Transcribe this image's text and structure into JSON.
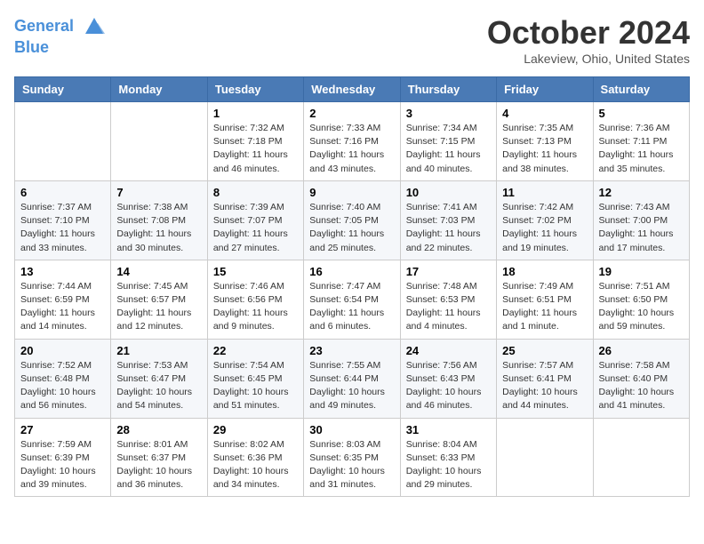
{
  "header": {
    "logo_line1": "General",
    "logo_line2": "Blue",
    "month": "October 2024",
    "location": "Lakeview, Ohio, United States"
  },
  "weekdays": [
    "Sunday",
    "Monday",
    "Tuesday",
    "Wednesday",
    "Thursday",
    "Friday",
    "Saturday"
  ],
  "weeks": [
    [
      {
        "day": "",
        "info": ""
      },
      {
        "day": "",
        "info": ""
      },
      {
        "day": "1",
        "info": "Sunrise: 7:32 AM\nSunset: 7:18 PM\nDaylight: 11 hours and 46 minutes."
      },
      {
        "day": "2",
        "info": "Sunrise: 7:33 AM\nSunset: 7:16 PM\nDaylight: 11 hours and 43 minutes."
      },
      {
        "day": "3",
        "info": "Sunrise: 7:34 AM\nSunset: 7:15 PM\nDaylight: 11 hours and 40 minutes."
      },
      {
        "day": "4",
        "info": "Sunrise: 7:35 AM\nSunset: 7:13 PM\nDaylight: 11 hours and 38 minutes."
      },
      {
        "day": "5",
        "info": "Sunrise: 7:36 AM\nSunset: 7:11 PM\nDaylight: 11 hours and 35 minutes."
      }
    ],
    [
      {
        "day": "6",
        "info": "Sunrise: 7:37 AM\nSunset: 7:10 PM\nDaylight: 11 hours and 33 minutes."
      },
      {
        "day": "7",
        "info": "Sunrise: 7:38 AM\nSunset: 7:08 PM\nDaylight: 11 hours and 30 minutes."
      },
      {
        "day": "8",
        "info": "Sunrise: 7:39 AM\nSunset: 7:07 PM\nDaylight: 11 hours and 27 minutes."
      },
      {
        "day": "9",
        "info": "Sunrise: 7:40 AM\nSunset: 7:05 PM\nDaylight: 11 hours and 25 minutes."
      },
      {
        "day": "10",
        "info": "Sunrise: 7:41 AM\nSunset: 7:03 PM\nDaylight: 11 hours and 22 minutes."
      },
      {
        "day": "11",
        "info": "Sunrise: 7:42 AM\nSunset: 7:02 PM\nDaylight: 11 hours and 19 minutes."
      },
      {
        "day": "12",
        "info": "Sunrise: 7:43 AM\nSunset: 7:00 PM\nDaylight: 11 hours and 17 minutes."
      }
    ],
    [
      {
        "day": "13",
        "info": "Sunrise: 7:44 AM\nSunset: 6:59 PM\nDaylight: 11 hours and 14 minutes."
      },
      {
        "day": "14",
        "info": "Sunrise: 7:45 AM\nSunset: 6:57 PM\nDaylight: 11 hours and 12 minutes."
      },
      {
        "day": "15",
        "info": "Sunrise: 7:46 AM\nSunset: 6:56 PM\nDaylight: 11 hours and 9 minutes."
      },
      {
        "day": "16",
        "info": "Sunrise: 7:47 AM\nSunset: 6:54 PM\nDaylight: 11 hours and 6 minutes."
      },
      {
        "day": "17",
        "info": "Sunrise: 7:48 AM\nSunset: 6:53 PM\nDaylight: 11 hours and 4 minutes."
      },
      {
        "day": "18",
        "info": "Sunrise: 7:49 AM\nSunset: 6:51 PM\nDaylight: 11 hours and 1 minute."
      },
      {
        "day": "19",
        "info": "Sunrise: 7:51 AM\nSunset: 6:50 PM\nDaylight: 10 hours and 59 minutes."
      }
    ],
    [
      {
        "day": "20",
        "info": "Sunrise: 7:52 AM\nSunset: 6:48 PM\nDaylight: 10 hours and 56 minutes."
      },
      {
        "day": "21",
        "info": "Sunrise: 7:53 AM\nSunset: 6:47 PM\nDaylight: 10 hours and 54 minutes."
      },
      {
        "day": "22",
        "info": "Sunrise: 7:54 AM\nSunset: 6:45 PM\nDaylight: 10 hours and 51 minutes."
      },
      {
        "day": "23",
        "info": "Sunrise: 7:55 AM\nSunset: 6:44 PM\nDaylight: 10 hours and 49 minutes."
      },
      {
        "day": "24",
        "info": "Sunrise: 7:56 AM\nSunset: 6:43 PM\nDaylight: 10 hours and 46 minutes."
      },
      {
        "day": "25",
        "info": "Sunrise: 7:57 AM\nSunset: 6:41 PM\nDaylight: 10 hours and 44 minutes."
      },
      {
        "day": "26",
        "info": "Sunrise: 7:58 AM\nSunset: 6:40 PM\nDaylight: 10 hours and 41 minutes."
      }
    ],
    [
      {
        "day": "27",
        "info": "Sunrise: 7:59 AM\nSunset: 6:39 PM\nDaylight: 10 hours and 39 minutes."
      },
      {
        "day": "28",
        "info": "Sunrise: 8:01 AM\nSunset: 6:37 PM\nDaylight: 10 hours and 36 minutes."
      },
      {
        "day": "29",
        "info": "Sunrise: 8:02 AM\nSunset: 6:36 PM\nDaylight: 10 hours and 34 minutes."
      },
      {
        "day": "30",
        "info": "Sunrise: 8:03 AM\nSunset: 6:35 PM\nDaylight: 10 hours and 31 minutes."
      },
      {
        "day": "31",
        "info": "Sunrise: 8:04 AM\nSunset: 6:33 PM\nDaylight: 10 hours and 29 minutes."
      },
      {
        "day": "",
        "info": ""
      },
      {
        "day": "",
        "info": ""
      }
    ]
  ]
}
